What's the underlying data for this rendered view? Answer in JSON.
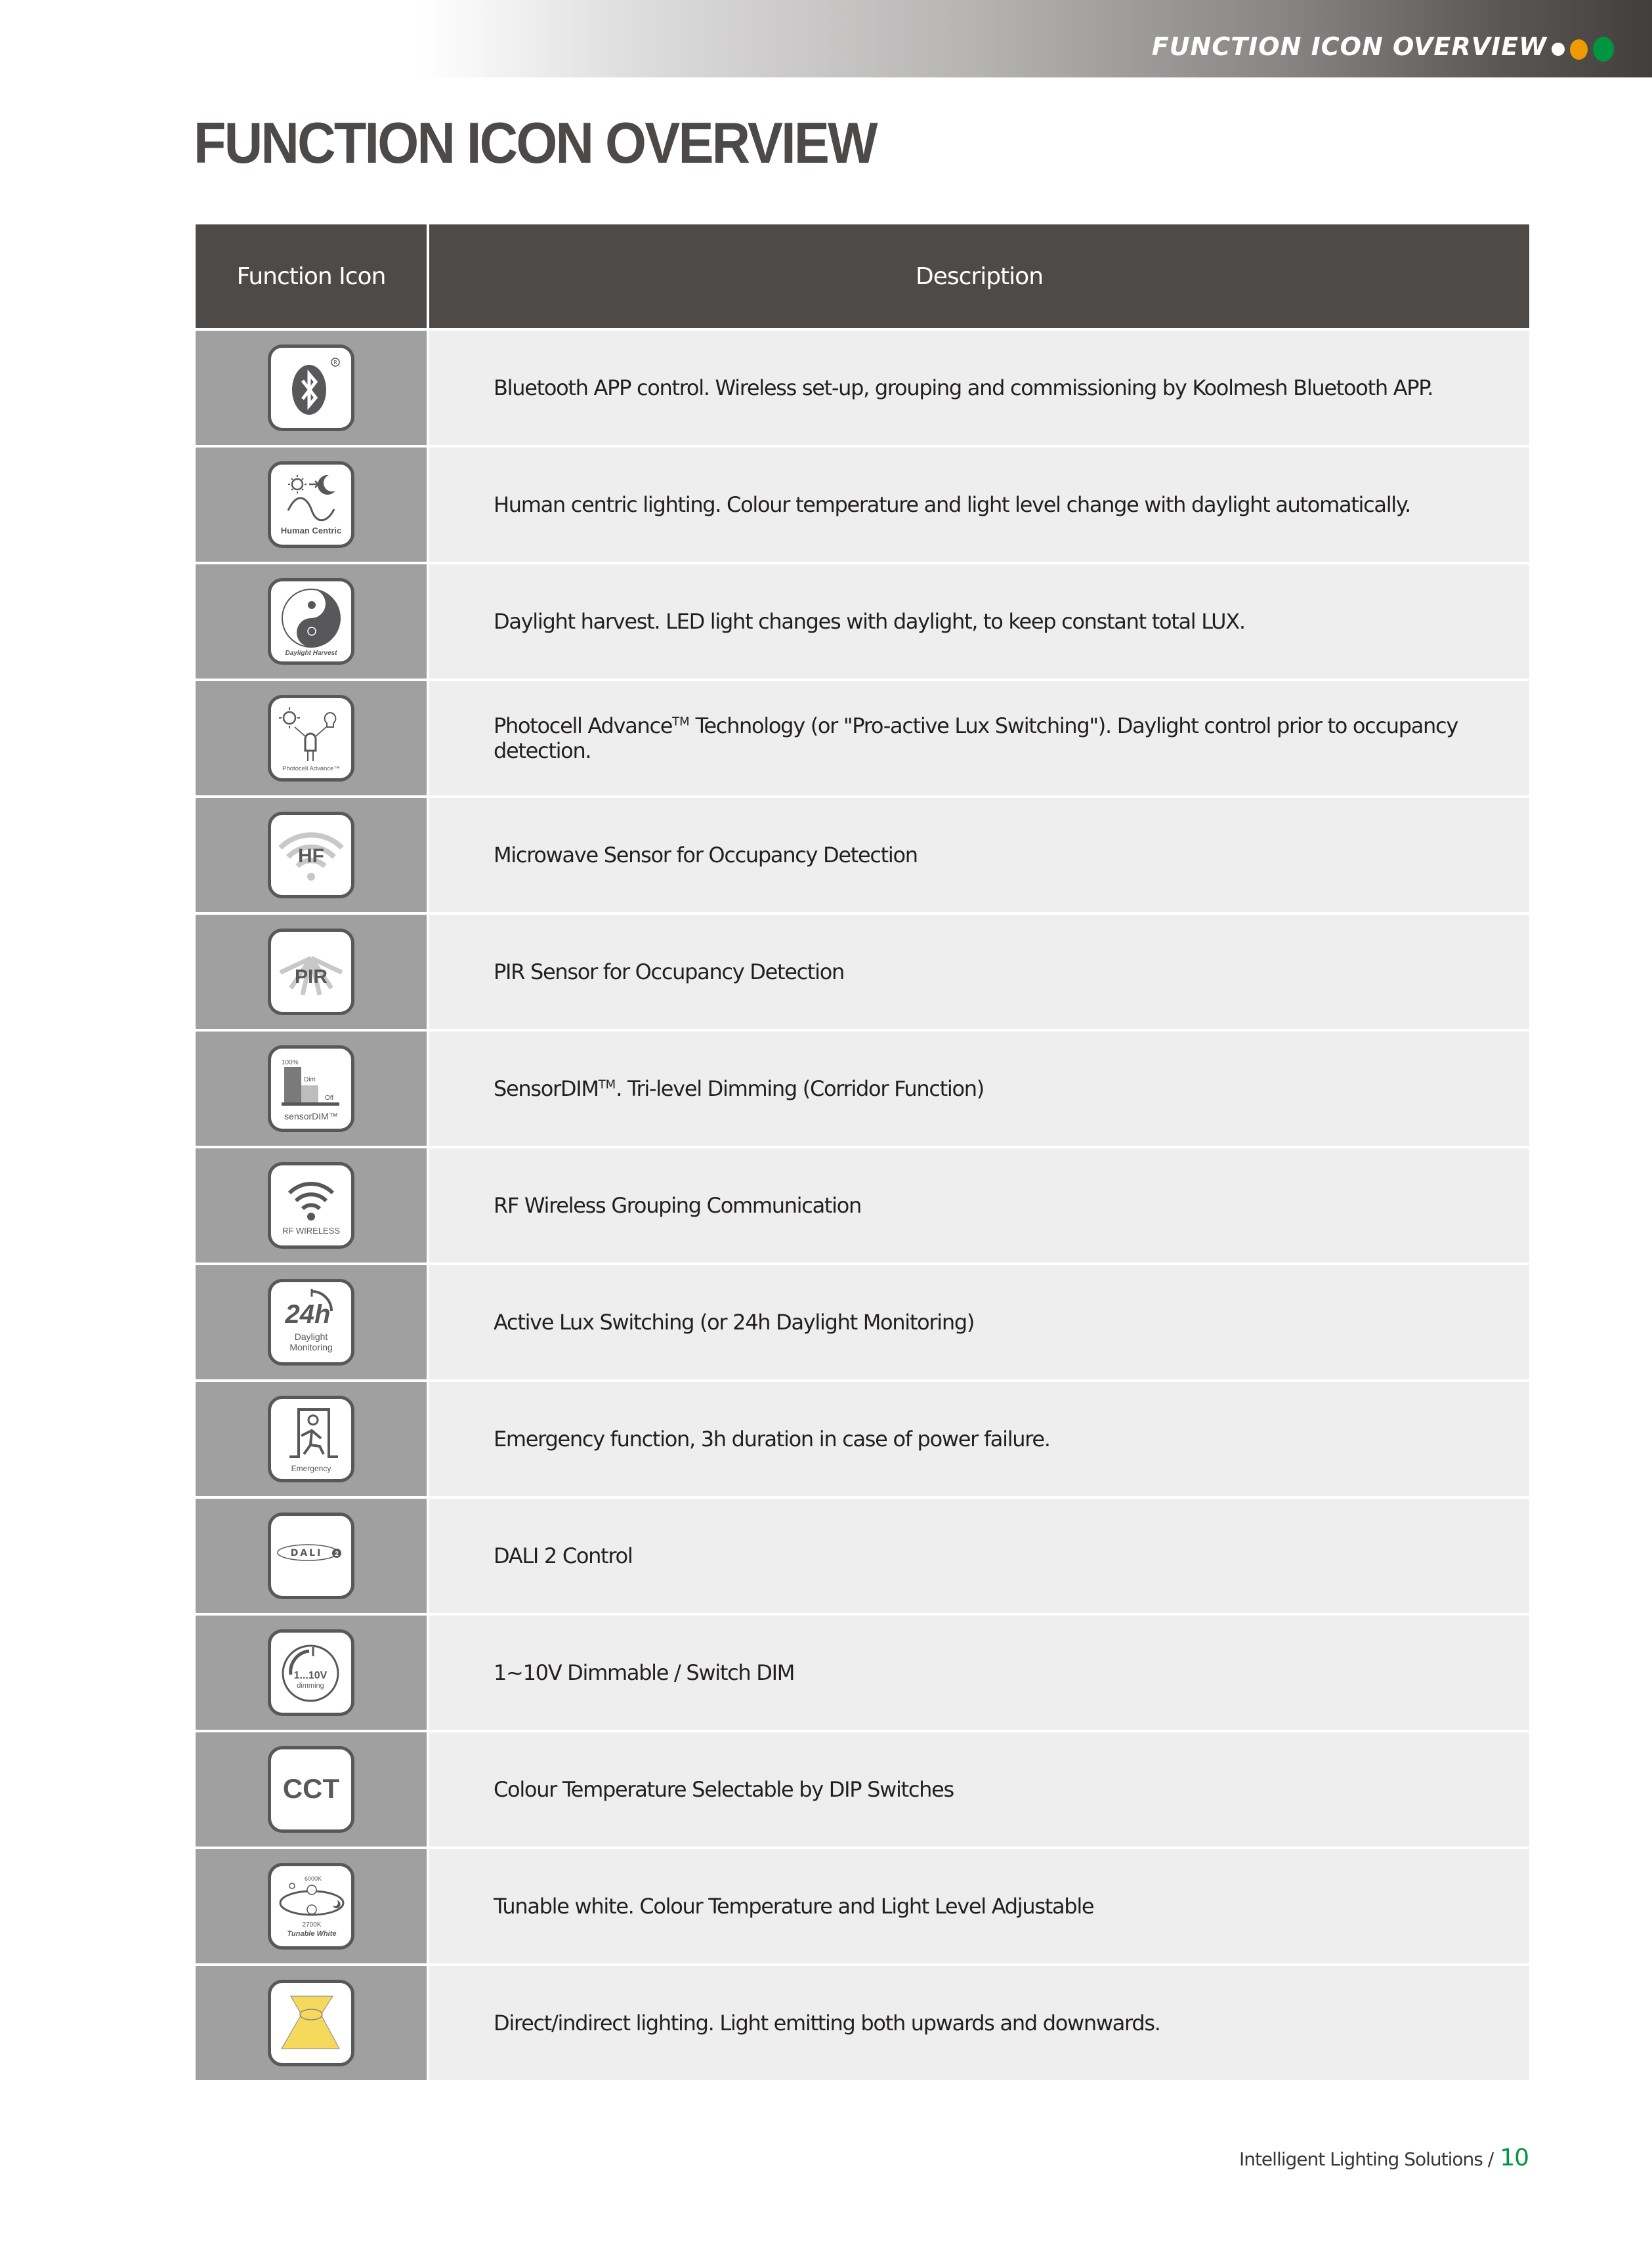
{
  "header_bar": {
    "title": "FUNCTION ICON OVERVIEW",
    "dot_colors": [
      "#ffffff",
      "#ef9a00",
      "#00963f"
    ]
  },
  "page_title": "FUNCTION ICON OVERVIEW",
  "table": {
    "columns": [
      "Function Icon",
      "Description"
    ],
    "rows": [
      {
        "icon": "bluetooth-icon",
        "icon_label": "",
        "description": "Bluetooth APP control. Wireless set-up, grouping and commissioning by Koolmesh Bluetooth APP."
      },
      {
        "icon": "human-centric-icon",
        "icon_label": "Human Centric",
        "description": "Human centric lighting. Colour temperature and light level change with daylight automatically."
      },
      {
        "icon": "daylight-harvest-icon",
        "icon_label": "Daylight Harvest",
        "description": "Daylight harvest. LED light changes with daylight, to keep constant total LUX."
      },
      {
        "icon": "photocell-advance-icon",
        "icon_label": "Photocell Advance™",
        "description_pre": "Photocell Advance",
        "description_sup": "TM",
        "description_post": " Technology (or \"Pro-active Lux Switching\"). Daylight control prior to occupancy detection."
      },
      {
        "icon": "hf-microwave-icon",
        "icon_label": "HF",
        "description": "Microwave Sensor for Occupancy Detection"
      },
      {
        "icon": "pir-sensor-icon",
        "icon_label": "PIR",
        "description": "PIR Sensor for Occupancy Detection"
      },
      {
        "icon": "sensordim-icon",
        "icon_label": "sensorDIM™",
        "icon_sublabels": [
          "100%",
          "Dim",
          "Off"
        ],
        "description_pre": "SensorDIM",
        "description_sup": "TM",
        "description_post": ". Tri-level Dimming (Corridor Function)"
      },
      {
        "icon": "rf-wireless-icon",
        "icon_label": "RF WIRELESS",
        "description": "RF Wireless Grouping Communication"
      },
      {
        "icon": "24h-daylight-monitoring-icon",
        "icon_label": "Daylight Monitoring",
        "icon_big": "24h",
        "description": "Active Lux Switching (or 24h Daylight Monitoring)"
      },
      {
        "icon": "emergency-icon",
        "icon_label": "Emergency",
        "description": "Emergency function, 3h duration in case of power failure."
      },
      {
        "icon": "dali-2-icon",
        "icon_label": "DALI 2",
        "description": "DALI 2 Control"
      },
      {
        "icon": "1-10v-dimming-icon",
        "icon_label": "1...10V dimming",
        "description": "1~10V Dimmable / Switch DIM"
      },
      {
        "icon": "cct-icon",
        "icon_label": "CCT",
        "description": "Colour Temperature Selectable by DIP Switches"
      },
      {
        "icon": "tunable-white-icon",
        "icon_label": "Tunable White",
        "icon_sublabels": [
          "6000K",
          "2700K"
        ],
        "description": "Tunable white. Colour Temperature and Light Level Adjustable"
      },
      {
        "icon": "direct-indirect-lighting-icon",
        "icon_label": "",
        "description": "Direct/indirect lighting. Light emitting both upwards and downwards."
      }
    ]
  },
  "footer": {
    "text": "Intelligent Lighting Solutions /",
    "page_number": "10"
  }
}
